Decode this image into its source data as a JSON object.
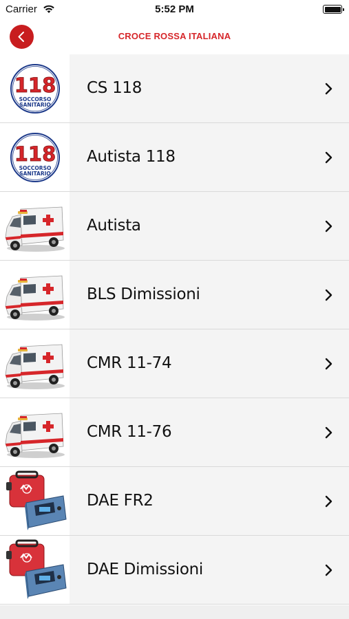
{
  "status_bar": {
    "carrier": "Carrier",
    "time": "5:52 PM",
    "wifi_icon": "wifi-icon",
    "battery_icon": "battery-icon"
  },
  "nav": {
    "title": "CROCE ROSSA ITALIANA",
    "back_icon": "chevron-left-icon",
    "accent_color": "#c81d1f"
  },
  "items": [
    {
      "label": "CS 118",
      "icon": "logo-118-icon"
    },
    {
      "label": "Autista 118",
      "icon": "logo-118-icon"
    },
    {
      "label": "Autista",
      "icon": "ambulance-icon"
    },
    {
      "label": "BLS Dimissioni",
      "icon": "ambulance-icon"
    },
    {
      "label": "CMR 11-74",
      "icon": "ambulance-icon"
    },
    {
      "label": "CMR 11-76",
      "icon": "ambulance-icon"
    },
    {
      "label": "DAE FR2",
      "icon": "defibrillator-icon"
    },
    {
      "label": "DAE Dimissioni",
      "icon": "defibrillator-icon"
    }
  ],
  "logo_118": {
    "number": "118",
    "line1": "SOCCORSO",
    "line2": "SANITARIO"
  }
}
